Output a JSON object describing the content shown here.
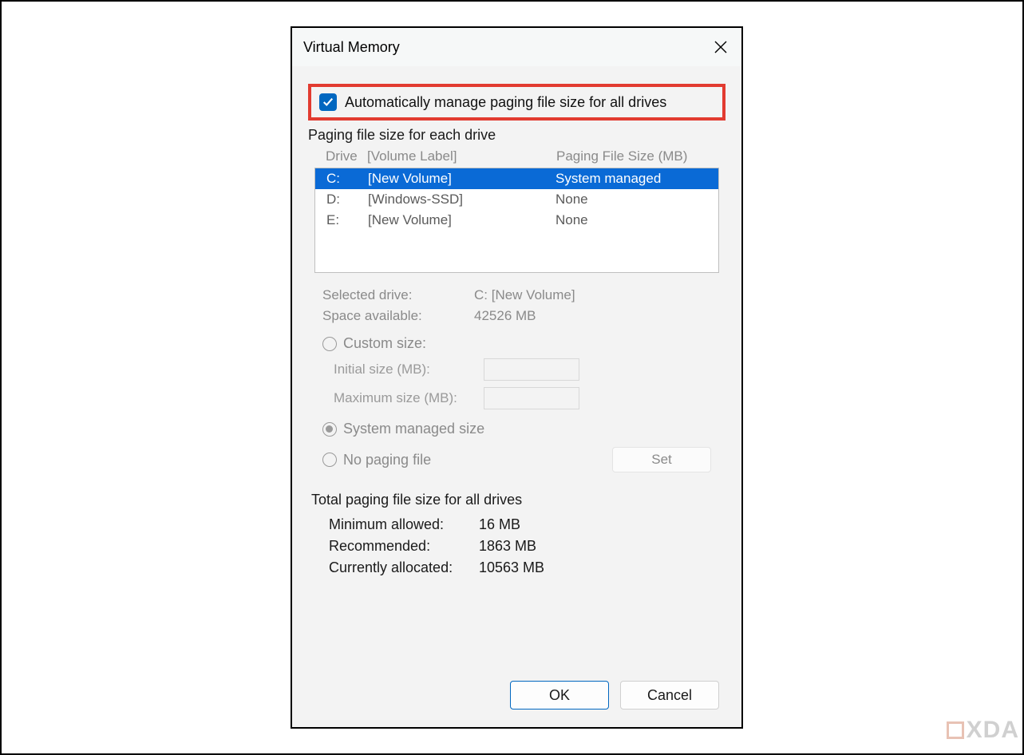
{
  "window": {
    "title": "Virtual Memory"
  },
  "auto_manage": {
    "label": "Automatically manage paging file size for all drives",
    "checked": true
  },
  "drives_group": {
    "title": "Paging file size for each drive",
    "headers": {
      "drive": "Drive",
      "volume": "[Volume Label]",
      "size": "Paging File Size (MB)"
    },
    "rows": [
      {
        "letter": "C:",
        "volume": "[New Volume]",
        "size": "System managed",
        "selected": true
      },
      {
        "letter": "D:",
        "volume": "[Windows-SSD]",
        "size": "None",
        "selected": false
      },
      {
        "letter": "E:",
        "volume": "[New Volume]",
        "size": "None",
        "selected": false
      }
    ]
  },
  "selected_drive": {
    "label": "Selected drive:",
    "value": "C:  [New Volume]"
  },
  "space_available": {
    "label": "Space available:",
    "value": "42526 MB"
  },
  "options": {
    "custom_size": "Custom size:",
    "initial_size": "Initial size (MB):",
    "maximum_size": "Maximum size (MB):",
    "system_managed": "System managed size",
    "no_paging": "No paging file",
    "set": "Set"
  },
  "totals": {
    "title": "Total paging file size for all drives",
    "minimum": {
      "label": "Minimum allowed:",
      "value": "16 MB"
    },
    "recommended": {
      "label": "Recommended:",
      "value": "1863 MB"
    },
    "allocated": {
      "label": "Currently allocated:",
      "value": "10563 MB"
    }
  },
  "buttons": {
    "ok": "OK",
    "cancel": "Cancel"
  },
  "watermark": "XDA"
}
